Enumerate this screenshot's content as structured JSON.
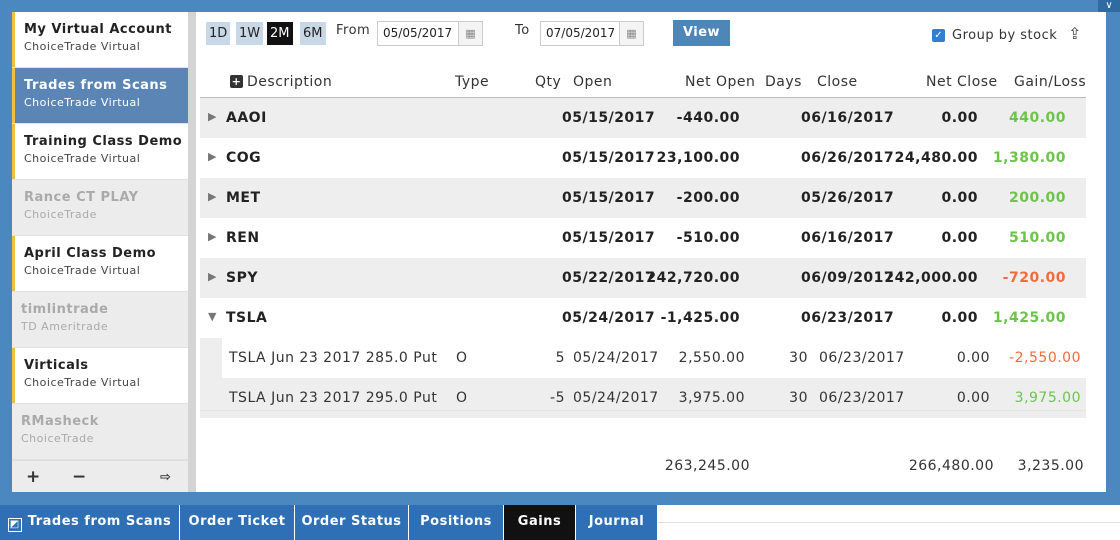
{
  "accounts": [
    {
      "name": "My Virtual Account",
      "broker": "ChoiceTrade Virtual"
    },
    {
      "name": "Trades from Scans",
      "broker": "ChoiceTrade Virtual"
    },
    {
      "name": "Training Class Demo",
      "broker": "ChoiceTrade Virtual"
    },
    {
      "name": "Rance CT PLAY",
      "broker": "ChoiceTrade"
    },
    {
      "name": "April Class Demo",
      "broker": "ChoiceTrade Virtual"
    },
    {
      "name": "timlintrade",
      "broker": "TD Ameritrade"
    },
    {
      "name": "Virticals",
      "broker": "ChoiceTrade Virtual"
    },
    {
      "name": "RMasheck",
      "broker": "ChoiceTrade"
    }
  ],
  "sidebar_footer": {
    "add": "+",
    "remove": "−",
    "logout": "⇨"
  },
  "toolbar": {
    "ranges": [
      "1D",
      "1W",
      "2M",
      "6M"
    ],
    "active_range": "2M",
    "from_label": "From",
    "from_date": "05/05/2017",
    "to_label": "To",
    "to_date": "07/05/2017",
    "view_label": "View",
    "group_by_label": "Group by stock",
    "group_by_checked": true
  },
  "columns": {
    "description": "Description",
    "type": "Type",
    "qty": "Qty",
    "open": "Open",
    "net_open": "Net Open",
    "days": "Days",
    "close": "Close",
    "net_close": "Net Close",
    "gain_loss": "Gain/Loss"
  },
  "groups": [
    {
      "symbol": "AAOI",
      "open": "05/15/2017",
      "net_open": "-440.00",
      "close": "06/16/2017",
      "net_close": "0.00",
      "gain_loss": "440.00"
    },
    {
      "symbol": "COG",
      "open": "05/15/2017",
      "net_open": "23,100.00",
      "close": "06/26/2017",
      "net_close": "24,480.00",
      "gain_loss": "1,380.00"
    },
    {
      "symbol": "MET",
      "open": "05/15/2017",
      "net_open": "-200.00",
      "close": "05/26/2017",
      "net_close": "0.00",
      "gain_loss": "200.00"
    },
    {
      "symbol": "REN",
      "open": "05/15/2017",
      "net_open": "-510.00",
      "close": "06/16/2017",
      "net_close": "0.00",
      "gain_loss": "510.00"
    },
    {
      "symbol": "SPY",
      "open": "05/22/2017",
      "net_open": "242,720.00",
      "close": "06/09/2017",
      "net_close": "242,000.00",
      "gain_loss": "-720.00"
    },
    {
      "symbol": "TSLA",
      "open": "05/24/2017",
      "net_open": "-1,425.00",
      "close": "06/23/2017",
      "net_close": "0.00",
      "gain_loss": "1,425.00"
    }
  ],
  "tsla_legs": [
    {
      "description": "TSLA Jun 23 2017 285.0 Put",
      "type": "O",
      "qty": "5",
      "open": "05/24/2017",
      "net_open": "2,550.00",
      "days": "30",
      "close": "06/23/2017",
      "net_close": "0.00",
      "gain_loss": "-2,550.00"
    },
    {
      "description": "TSLA Jun 23 2017 295.0 Put",
      "type": "O",
      "qty": "-5",
      "open": "05/24/2017",
      "net_open": "3,975.00",
      "days": "30",
      "close": "06/23/2017",
      "net_close": "0.00",
      "gain_loss": "3,975.00"
    }
  ],
  "totals": {
    "net_open": "263,245.00",
    "net_close": "266,480.00",
    "gain_loss": "3,235.00"
  },
  "tabs": [
    "Trades from Scans",
    "Order Ticket",
    "Order Status",
    "Positions",
    "Gains",
    "Journal"
  ],
  "active_tab": "Gains",
  "colors": {
    "gain": "#6cc54a",
    "loss": "#ef6d3b",
    "accent": "#4a88bf",
    "tab": "#2e6fb6"
  }
}
